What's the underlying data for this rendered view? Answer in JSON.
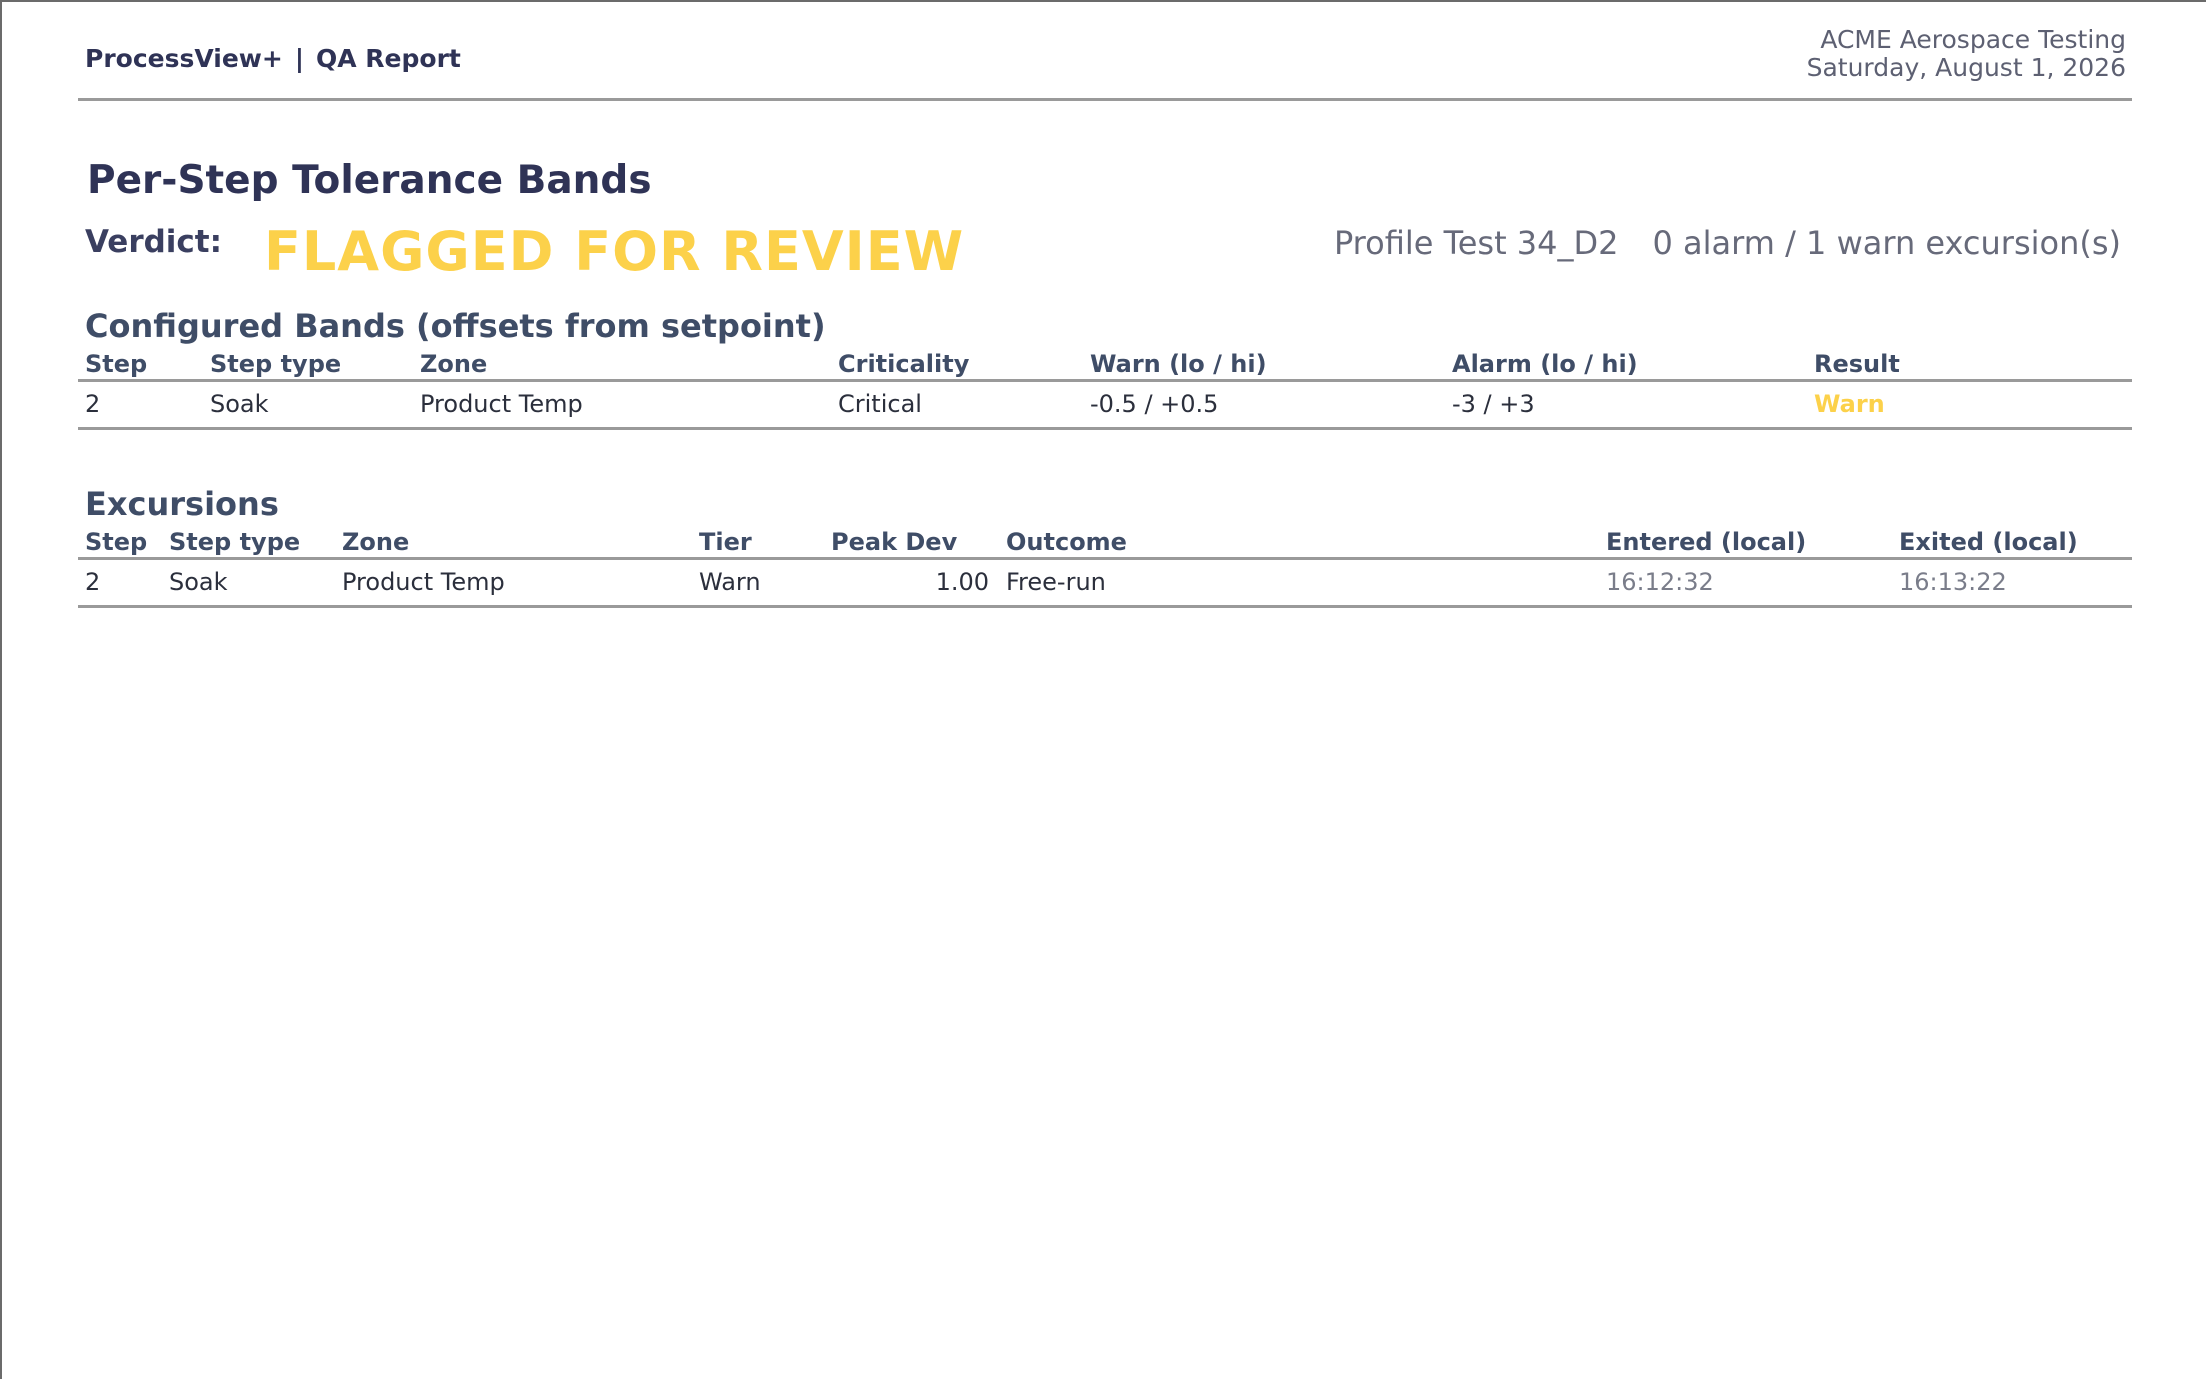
{
  "header": {
    "app_name": "ProcessView+",
    "separator": "|",
    "report_name": "QA Report",
    "company": "ACME Aerospace Testing",
    "date": "Saturday, August 1, 2026"
  },
  "report": {
    "title": "Per-Step Tolerance Bands",
    "verdict_label": "Verdict:",
    "verdict_value": "FLAGGED FOR REVIEW",
    "profile": "Profile Test 34_D2",
    "excursion_summary": "0 alarm / 1 warn excursion(s)"
  },
  "configured_bands": {
    "title": "Configured Bands  (offsets from setpoint)",
    "columns": [
      "Step",
      "Step type",
      "Zone",
      "Criticality",
      "Warn (lo / hi)",
      "Alarm (lo / hi)",
      "Result"
    ],
    "rows": [
      {
        "step": "2",
        "step_type": "Soak",
        "zone": "Product Temp",
        "criticality": "Critical",
        "warn": "-0.5 / +0.5",
        "alarm": "-3 / +3",
        "result": "Warn"
      }
    ]
  },
  "excursions": {
    "title": "Excursions",
    "columns": [
      "Step",
      "Step type",
      "Zone",
      "Tier",
      "Peak Dev",
      "Outcome",
      "Entered (local)",
      "Exited (local)"
    ],
    "rows": [
      {
        "step": "2",
        "step_type": "Soak",
        "zone": "Product Temp",
        "tier": "Warn",
        "peak_dev": "1.00",
        "outcome": "Free-run",
        "entered": "16:12:32",
        "exited": "16:13:22"
      }
    ]
  },
  "colors": {
    "verdict": "#fcd14a",
    "heading": "#2f3356",
    "rule": "#9a9a9a"
  }
}
